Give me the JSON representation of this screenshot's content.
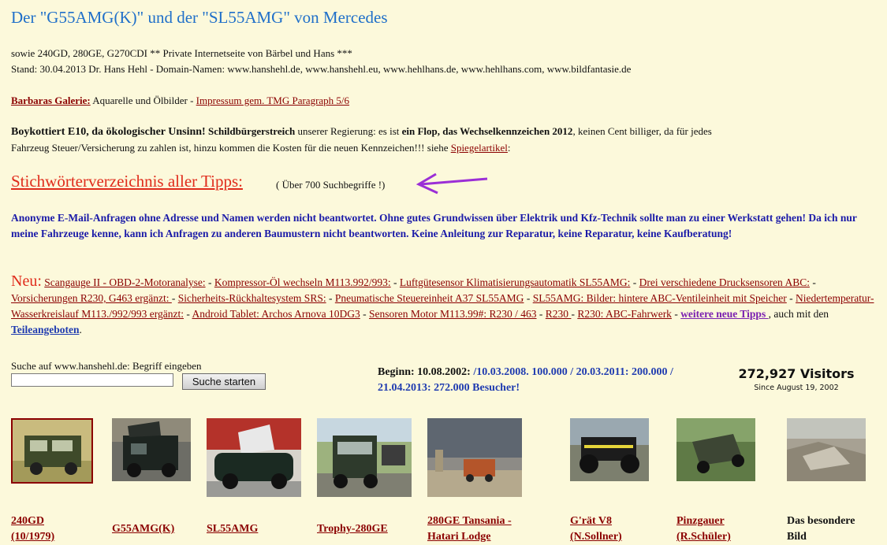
{
  "header": {
    "title": "Der \"G55AMG(K)\" und der \"SL55AMG\" von Mercedes",
    "line1": "sowie 240GD, 280GE, G270CDI ** Private Internetseite von Bärbel und Hans ***",
    "line2": "Stand: 30.04.2013 Dr. Hans Hehl - Domain-Namen: www.hanshehl.de, www.hanshehl.eu, www.hehlhans.de, www.hehlhans.com, www.bildfantasie.de"
  },
  "galerie": {
    "link": "Barbaras Galerie:",
    "text": " Aquarelle und Ölbilder - ",
    "impressum": "Impressum gem. TMG Paragraph 5/6"
  },
  "boykott": {
    "b1": "Boykottiert E10, da ökologischer Unsinn!",
    "b2": " Schildbürgerstreich",
    "t1": " unserer Regierung: es ist ",
    "b3": "ein Flop, das Wechselkennzeichen 2012",
    "t2": ", keinen Cent billiger, da für jedes",
    "t3": "Fahrzeug Steuer/Versicherung zu zahlen ist, hinzu kommen die Kosten für die neuen Kennzeichen!!! siehe ",
    "link": "Spiegelartikel",
    "t4": ":"
  },
  "stichwort": {
    "link": "Stichwörterverzeichnis aller Tipps: ",
    "note": "( Über 700 Suchbegriffe !)"
  },
  "notice": "Anonyme E-Mail-Anfragen ohne Adresse und Namen werden nicht beantwortet. Ohne gutes Grundwissen über Elektrik und Kfz-Technik sollte man zu einer Werkstatt gehen! Da ich nur meine Fahrzeuge kenne, kann ich Anfragen zu anderen Baumustern nicht beantworten. Keine Anleitung zur Reparatur, keine Reparatur, keine Kaufberatung!",
  "neu": {
    "label": "Neu:",
    "links": [
      "Scangauge II - OBD-2-Motoranalyse:",
      "Kompressor-Öl wechseln M113.992/993:",
      "Luftgütesensor Klimatisierungsautomatik SL55AMG:",
      "Drei verschiedene Drucksensoren ABC:",
      "Vorsicherungen R230, G463 ergänzt: ",
      "Sicherheits-Rückhaltesystem SRS:",
      "Pneumatische Steuereinheit A37 SL55AMG",
      "SL55AMG: Bilder: hintere ABC-Ventileinheit mit Speicher",
      "Niedertemperatur-Wasserkreislauf M113./992/993 ergänzt:",
      "Android Tablet: Archos Arnova 10DG3",
      "Sensoren Motor M113.99#: R230 / 463",
      "R230 ",
      "R230: ABC-Fahrwerk"
    ],
    "more": "weitere neue Tipps ",
    "more_text": ", auch mit den ",
    "teile": "Teileangeboten",
    "end": "."
  },
  "search": {
    "label": "Suche auf www.hanshehl.de: Begriff eingeben",
    "value": "",
    "button": "Suche starten"
  },
  "stats": {
    "beginn_label": "Beginn: 10.08.2002: ",
    "beginn_rest": "/10.03.2008. 100.000 / 20.03.2011: 200.000 / 21.04.2013: 272.000 Besucher!",
    "visitors": "272,927 Visitors",
    "since": "Since August 19, 2002"
  },
  "gallery": [
    {
      "l1": "240GD",
      "l2": "(10/1979)"
    },
    {
      "l1": "G55AMG(K)",
      "l2": ""
    },
    {
      "l1": "SL55AMG",
      "l2": ""
    },
    {
      "l1": "Trophy-280GE",
      "l2": ""
    },
    {
      "l1": "280GE Tansania -",
      "l2": "Hatari Lodge"
    },
    {
      "l1": "G'rät V8",
      "l2": "(N.Sollner)"
    },
    {
      "l1": "Pinzgauer",
      "l2": "(R.Schüler)"
    },
    {
      "l1": "Das besondere",
      "l2": "Bild"
    }
  ],
  "colors": {
    "background": "#fcf9db",
    "title": "#1f6fc9",
    "link": "#8b0000",
    "highlight_red": "#e02b1b",
    "notice_blue": "#1b1ba8",
    "arrow_purple": "#9b2fd6"
  }
}
